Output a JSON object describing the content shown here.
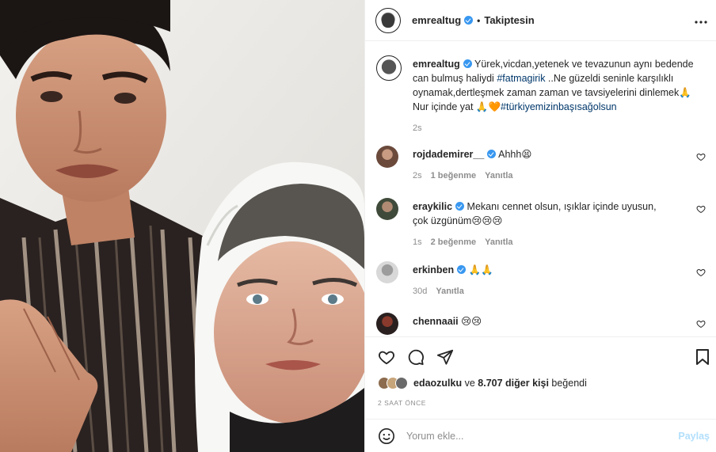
{
  "header": {
    "username": "emrealtug",
    "separator": "•",
    "follow_status": "Takiptesin",
    "more_icon": "more-horizontal-icon"
  },
  "caption": {
    "username": "emrealtug",
    "text_1": "Yürek,vicdan,yetenek ve tevazunun aynı bedende can bulmuş haliydi ",
    "hashtag_1": "#fatmagirik",
    "text_2": " ..Ne güzeldi seninle karşılıklı oynamak,dertleşmek zaman zaman ve tavsiyelerini dinlemek🙏 Nur içinde yat 🙏🧡",
    "hashtag_2": "#türkiyemizinbaşısağolsun",
    "time": "2s"
  },
  "comments": [
    {
      "username": "rojdademirer__",
      "verified": true,
      "text": "Ahhh😫",
      "time": "2s",
      "likes": "1 beğenme",
      "reply": "Yanıtla"
    },
    {
      "username": "eraykilic",
      "verified": true,
      "text": "Mekanı cennet olsun, ışıklar içinde uyusun, çok üzgünüm😢😢😢",
      "time": "1s",
      "likes": "2 beğenme",
      "reply": "Yanıtla"
    },
    {
      "username": "erkinben",
      "verified": true,
      "text": "🙏🙏",
      "time": "30d",
      "likes": "",
      "reply": "Yanıtla"
    },
    {
      "username": "chennaaii",
      "verified": false,
      "text": "😢😢",
      "time": "",
      "likes": "",
      "reply": ""
    }
  ],
  "actions": {
    "like_icon": "heart-icon",
    "comment_icon": "comment-icon",
    "share_icon": "paper-plane-icon",
    "save_icon": "bookmark-icon"
  },
  "likes": {
    "first_user": "edaozulku",
    "connector": " ve ",
    "others": "8.707 diğer kişi",
    "suffix": " beğendi"
  },
  "posted_time": "2 SAAT ÖNCE",
  "comment_input": {
    "placeholder": "Yorum ekle...",
    "post_label": "Paylaş"
  },
  "colors": {
    "link": "#00376b",
    "verified": "#3897f0",
    "muted": "#8e8e8e",
    "post_button_disabled": "#b2dffc"
  }
}
